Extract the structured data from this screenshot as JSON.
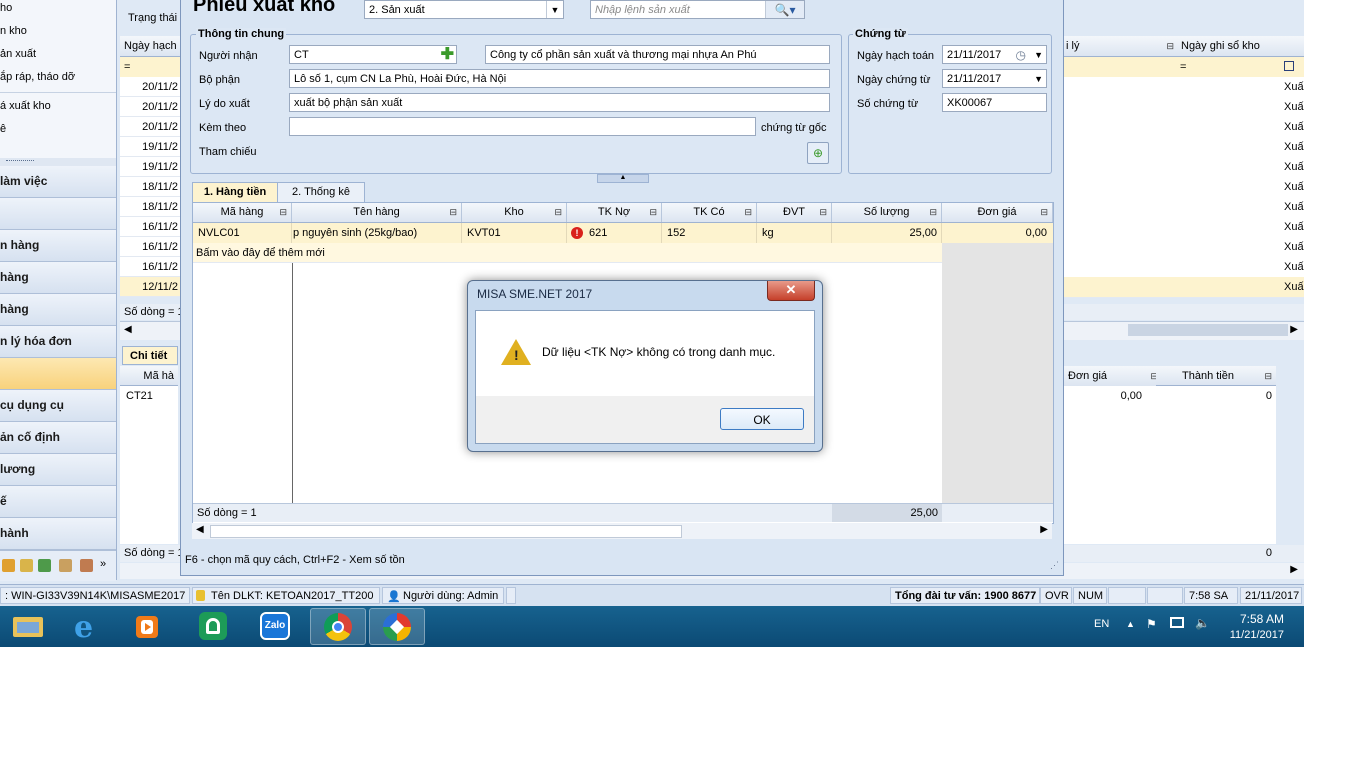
{
  "left_nav": {
    "sub_items": [
      "ho",
      "n kho",
      "ản xuất",
      "ắp ráp, tháo dỡ",
      "á xuất kho",
      "ê"
    ],
    "main_items": [
      "làm việc",
      "",
      "n hàng",
      "hàng",
      "hàng",
      "n lý hóa đơn",
      "",
      "cụ dụng cụ",
      "ản cố định",
      "lương",
      "ế",
      "hành"
    ]
  },
  "bg_list": {
    "filter_label": "Trạng thái",
    "col_date": "Ngày hạch",
    "col_reason": "i lý",
    "col_post_date": "Ngày ghi sổ kho",
    "filter_eq": "=",
    "dates": [
      "20/11/2",
      "20/11/2",
      "20/11/2",
      "19/11/2",
      "19/11/2",
      "18/11/2",
      "18/11/2",
      "16/11/2",
      "16/11/2",
      "16/11/2",
      "12/11/2"
    ],
    "right_values": [
      "Xuấ",
      "Xuấ",
      "Xuấ",
      "Xuấ",
      "Xuấ",
      "Xuấ",
      "Xuấ",
      "Xuấ",
      "Xuấ",
      "Xuấ",
      "Xuấ"
    ],
    "row_count_label": "Số dòng = 1",
    "detail_tab": "Chi tiết",
    "detail_col_code": "Mã hà",
    "detail_col_price": "Đơn giá",
    "detail_col_amount": "Thành tiền",
    "detail_code": "CT21",
    "detail_price": "0,00",
    "detail_amount": "0",
    "detail_row_count": "Số dòng = 1",
    "detail_total": "0"
  },
  "form": {
    "title": "Phiếu xuất kho",
    "type_select": "2. Sản xuất",
    "search_placeholder": "Nhập lệnh sản xuất",
    "general_title": "Thông tin chung",
    "receiver_label": "Người nhận",
    "receiver_code": "CT",
    "receiver_name": "Công ty cổ phần sản xuất và thương mại nhựa An Phú",
    "dept_label": "Bộ phận",
    "dept_value": "Lô số 1, cụm CN La Phù, Hoài Đức, Hà Nội",
    "reason_label": "Lý do xuất",
    "reason_value": "xuất bộ phận sản xuất",
    "attach_label": "Kèm theo",
    "attach_value": "",
    "attach_suffix": "chứng từ gốc",
    "ref_label": "Tham chiếu",
    "voucher_title": "Chứng từ",
    "post_date_label": "Ngày hạch toán",
    "post_date": "21/11/2017",
    "voucher_date_label": "Ngày chứng từ",
    "voucher_date": "21/11/2017",
    "voucher_no_label": "Số chứng từ",
    "voucher_no": "XK00067",
    "tab1": "1. Hàng tiền",
    "tab2": "2. Thống kê",
    "columns": [
      "Mã hàng",
      "Tên hàng",
      "Kho",
      "TK Nợ",
      "TK Có",
      "ĐVT",
      "Số lượng",
      "Đơn giá"
    ],
    "row": {
      "code": "NVLC01",
      "name": "p nguyên sinh (25kg/bao)",
      "warehouse": "KVT01",
      "debit": "621",
      "credit": "152",
      "unit": "kg",
      "qty": "25,00",
      "price": "0,00"
    },
    "add_row_hint": "Bấm vào đây để thêm mới",
    "row_count": "Số dòng = 1",
    "total_qty": "25,00",
    "hint": "F6 - chọn mã quy cách, Ctrl+F2 - Xem số tồn"
  },
  "message_box": {
    "title": "MISA SME.NET 2017",
    "text": "Dữ liệu <TK Nợ> không có trong danh mục.",
    "ok_label": "OK"
  },
  "status_bar": {
    "server": ": WIN-GI33V39N14K\\MISASME2017",
    "db": "Tên DLKT: KETOAN2017_TT200",
    "user": "Người dùng: Admin",
    "hotline": "Tổng đài tư vấn: 1900 8677",
    "ovr": "OVR",
    "num": "NUM",
    "time": "7:58 SA",
    "date": "21/11/2017"
  },
  "taskbar": {
    "lang": "EN",
    "clock_time": "7:58 AM",
    "clock_date": "11/21/2017",
    "apps": [
      "file-explorer-icon",
      "internet-explorer-icon",
      "media-player-icon",
      "home-app-icon",
      "zalo-icon",
      "chrome-icon",
      "misa-icon"
    ],
    "zalo_label": "Zalo"
  },
  "colors": {
    "accent_blue": "#dfe9f5",
    "highlight_row": "#fdf3cf",
    "taskbar": "#0b4a74",
    "error_red": "#d9211c"
  }
}
